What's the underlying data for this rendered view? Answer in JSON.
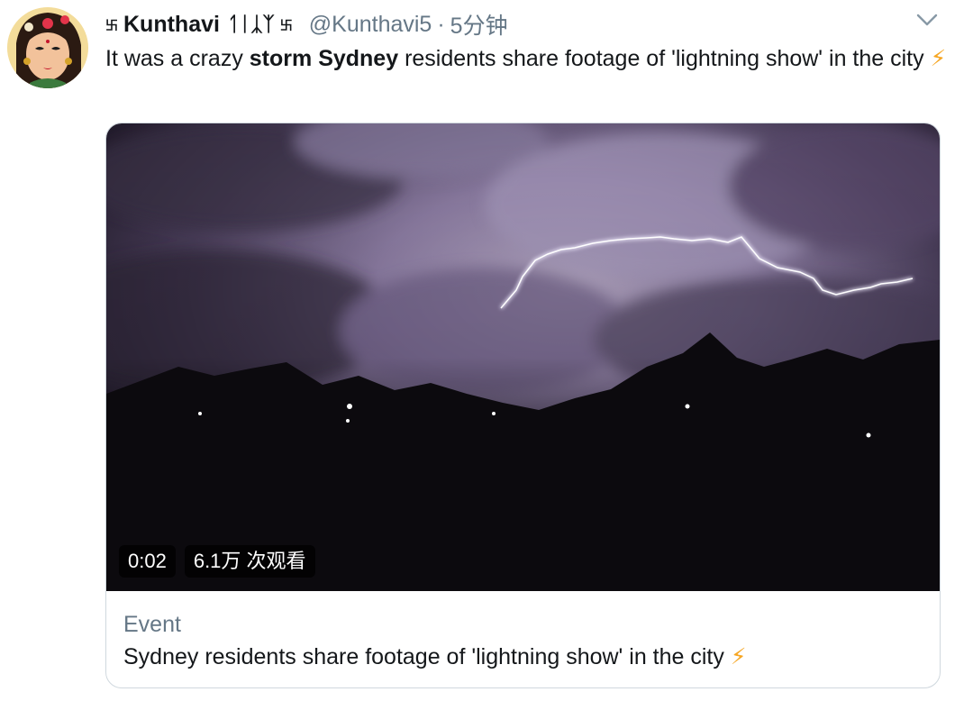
{
  "tweet": {
    "name": "Kunthavi",
    "name_suffix": "ᛐᛁᛣᛉ",
    "handle": "@Kunthavi5",
    "dot": "·",
    "time": "5分钟",
    "text_parts": [
      {
        "t": "It was a crazy ",
        "b": false
      },
      {
        "t": "storm",
        "b": true
      },
      {
        "t": "  ",
        "b": false
      },
      {
        "t": "Sydney",
        "b": true
      },
      {
        "t": " residents share footage of 'lightning show' in the city ",
        "b": false
      }
    ],
    "emoji": "⚡"
  },
  "media": {
    "duration": "0:02",
    "views": "6.1万 次观看"
  },
  "card": {
    "label": "Event",
    "title": "Sydney residents share footage of 'lightning show' in the city ",
    "emoji": "⚡"
  },
  "icons": {
    "menu": "chevron-down-icon",
    "prefix_symbol": "卐"
  },
  "colors": {
    "text": "#14171a",
    "muted": "#657786",
    "bolt": "#f6a623",
    "border": "#d0d8de"
  }
}
